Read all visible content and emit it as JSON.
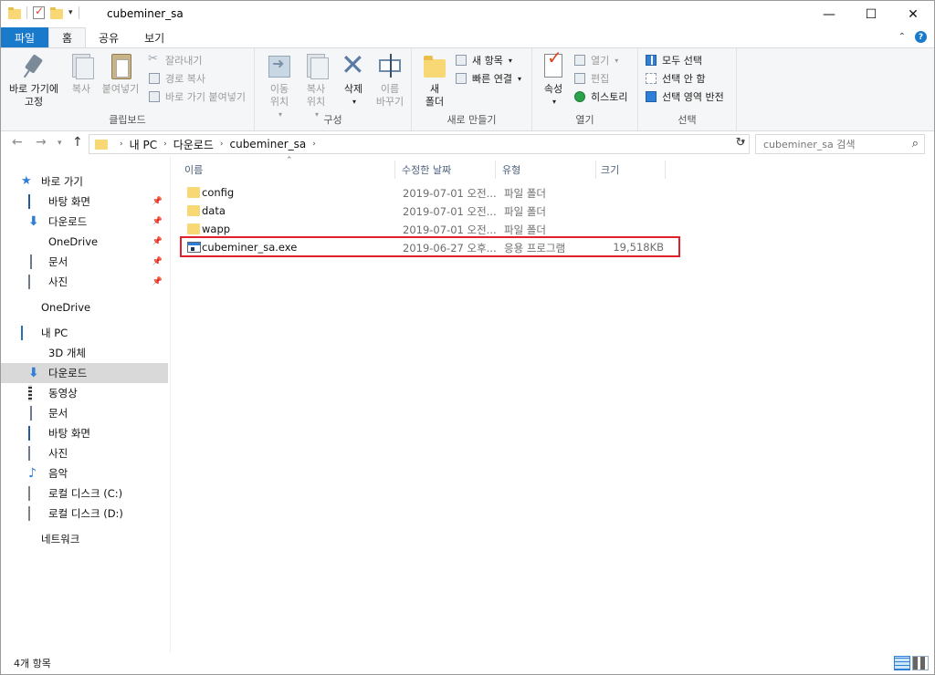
{
  "window": {
    "title": "cubeminer_sa",
    "controls": {
      "minimize": "—",
      "maximize": "☐",
      "close": "✕"
    }
  },
  "tabs": [
    {
      "label": "파일"
    },
    {
      "label": "홈"
    },
    {
      "label": "공유"
    },
    {
      "label": "보기"
    }
  ],
  "ribbon": {
    "clipboard": {
      "pin": "바로 가기에",
      "pin2": "고정",
      "copy": "복사",
      "paste": "붙여넣기",
      "cut": "잘라내기",
      "copy_path": "경로 복사",
      "paste_shortcut": "바로 가기 붙여넣기",
      "label": "클립보드"
    },
    "organize": {
      "move1": "이동",
      "move2": "위치",
      "copyto1": "복사",
      "copyto2": "위치",
      "delete": "삭제",
      "rename1": "이름",
      "rename2": "바꾸기",
      "label": "구성"
    },
    "new": {
      "folder1": "새",
      "folder2": "폴더",
      "new_item": "새 항목",
      "easy_access": "빠른 연결",
      "label": "새로 만들기"
    },
    "open": {
      "properties": "속성",
      "open": "열기",
      "edit": "편집",
      "history": "히스토리",
      "label": "열기"
    },
    "select": {
      "select_all": "모두 선택",
      "select_none": "선택 안 함",
      "invert": "선택 영역 반전",
      "label": "선택"
    }
  },
  "address": {
    "crumbs": [
      "내 PC",
      "다운로드",
      "cubeminer_sa"
    ],
    "search_placeholder": "cubeminer_sa 검색"
  },
  "sidebar": {
    "quick_access": "바로 가기",
    "quick_items": [
      {
        "label": "바탕 화면",
        "icon": "desktop-icon"
      },
      {
        "label": "다운로드",
        "icon": "download-icon"
      },
      {
        "label": "OneDrive",
        "icon": "onedrive-icon"
      },
      {
        "label": "문서",
        "icon": "document-icon"
      },
      {
        "label": "사진",
        "icon": "pictures-icon"
      }
    ],
    "onedrive": "OneDrive",
    "this_pc": "내 PC",
    "pc_items": [
      {
        "label": "3D 개체",
        "icon": "3d-objects-icon"
      },
      {
        "label": "다운로드",
        "icon": "download-icon"
      },
      {
        "label": "동영상",
        "icon": "videos-icon"
      },
      {
        "label": "문서",
        "icon": "document-icon"
      },
      {
        "label": "바탕 화면",
        "icon": "desktop-icon"
      },
      {
        "label": "사진",
        "icon": "pictures-icon"
      },
      {
        "label": "음악",
        "icon": "music-icon"
      },
      {
        "label": "로컬 디스크 (C:)",
        "icon": "drive-icon"
      },
      {
        "label": "로컬 디스크 (D:)",
        "icon": "drive-icon"
      }
    ],
    "network": "네트워크"
  },
  "columns": {
    "name": "이름",
    "date": "수정한 날짜",
    "type": "유형",
    "size": "크기"
  },
  "files": [
    {
      "name": "config",
      "date": "2019-07-01 오전...",
      "type": "파일 폴더",
      "size": "",
      "kind": "folder"
    },
    {
      "name": "data",
      "date": "2019-07-01 오전...",
      "type": "파일 폴더",
      "size": "",
      "kind": "folder"
    },
    {
      "name": "wapp",
      "date": "2019-07-01 오전...",
      "type": "파일 폴더",
      "size": "",
      "kind": "folder"
    },
    {
      "name": "cubeminer_sa.exe",
      "date": "2019-06-27 오후...",
      "type": "응용 프로그램",
      "size": "19,518KB",
      "kind": "exe"
    }
  ],
  "status": {
    "count": "4개 항목"
  },
  "colors": {
    "accent": "#1979ca",
    "highlight_box": "#e0202a",
    "folder": "#f8d775"
  }
}
